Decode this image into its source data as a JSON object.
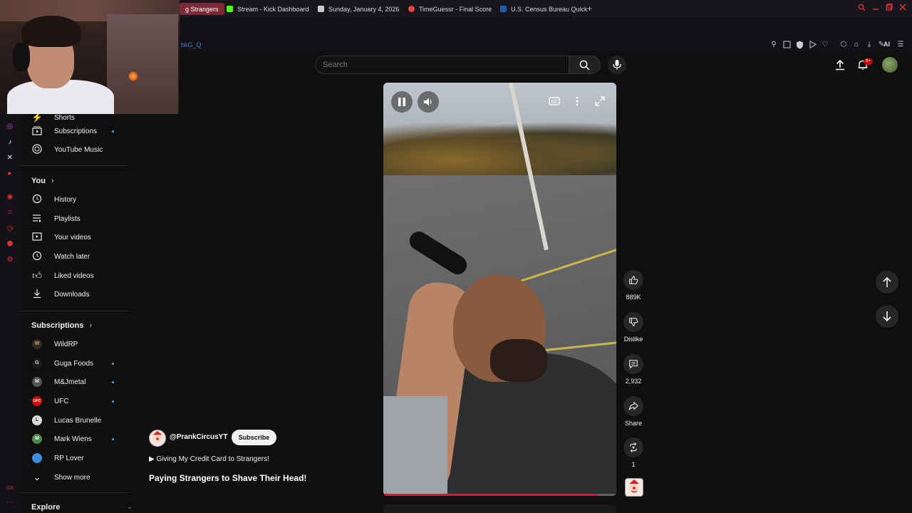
{
  "browser": {
    "tabs": [
      {
        "label": "g Strangers",
        "active": true,
        "color": "#e14b5a"
      },
      {
        "label": "Stream - Kick Dashboard",
        "color": "#53fc18"
      },
      {
        "label": "Sunday, January 4, 2026",
        "color": "#dddddd"
      },
      {
        "label": "TimeGuessr - Final Score",
        "color": "#e24646"
      },
      {
        "label": "U.S. Census Bureau Quick",
        "color": "#1f5fa8"
      }
    ],
    "new_tab": "+",
    "url": "bkG_Q",
    "ai_label": "AI"
  },
  "sidebar": {
    "items_top": [
      {
        "label": "Shorts",
        "icon": "shorts-icon"
      },
      {
        "label": "Subscriptions",
        "icon": "subscriptions-icon",
        "dot": true
      },
      {
        "label": "YouTube Music",
        "icon": "music-icon"
      }
    ],
    "you_heading": "You",
    "you_items": [
      {
        "label": "History",
        "icon": "history-icon"
      },
      {
        "label": "Playlists",
        "icon": "playlists-icon"
      },
      {
        "label": "Your videos",
        "icon": "your-videos-icon"
      },
      {
        "label": "Watch later",
        "icon": "watch-later-icon"
      },
      {
        "label": "Liked videos",
        "icon": "liked-videos-icon"
      },
      {
        "label": "Downloads",
        "icon": "downloads-icon"
      }
    ],
    "subs_heading": "Subscriptions",
    "subscriptions": [
      {
        "label": "WildRP",
        "dot": false,
        "avatar_color": "#2b2b2b",
        "avatar_text": "W"
      },
      {
        "label": "Guga Foods",
        "dot": true,
        "avatar_color": "#1e1e1e",
        "avatar_text": "G"
      },
      {
        "label": "M&Jmetal",
        "dot": true,
        "avatar_color": "#555555",
        "avatar_text": "M"
      },
      {
        "label": "UFC",
        "dot": true,
        "avatar_color": "#d20a0a",
        "avatar_text": "UFC"
      },
      {
        "label": "Lucas Brunelle",
        "dot": false,
        "avatar_color": "#dddddd",
        "avatar_text": "L"
      },
      {
        "label": "Mark Wiens",
        "dot": true,
        "avatar_color": "#4c8a4c",
        "avatar_text": "M"
      },
      {
        "label": "RP Lover",
        "dot": false,
        "avatar_color": "#3a8dde",
        "avatar_text": ""
      }
    ],
    "show_more": "Show more",
    "explore_heading": "Explore"
  },
  "header": {
    "search_placeholder": "Search",
    "notification_count": "9+"
  },
  "video": {
    "progress": 0.92,
    "likes": "889K",
    "dislike_label": "Dislike",
    "comments": "2,932",
    "share_label": "Share",
    "remix_count": "1"
  },
  "channel": {
    "handle": "@PrankCircusYT",
    "subscribe_label": "Subscribe"
  },
  "playlist_link": "▶ Giving My Credit Card to Strangers!",
  "title": "Paying Strangers to Shave Their Head!"
}
